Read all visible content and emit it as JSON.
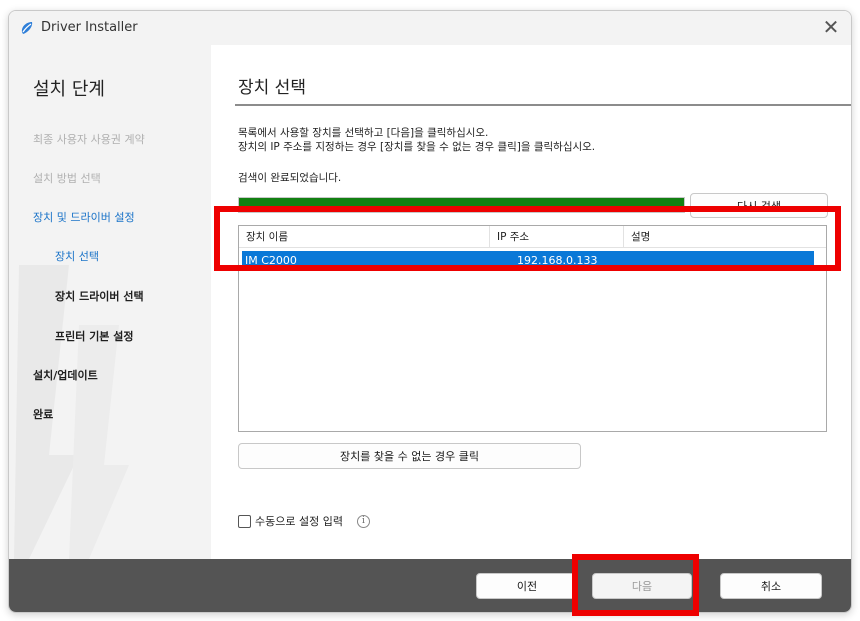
{
  "window": {
    "title": "Driver Installer",
    "close_glyph": "✕"
  },
  "sidebar": {
    "heading": "설치 단계",
    "steps": [
      {
        "label": "최종 사용자 사용권 계약",
        "state": "done"
      },
      {
        "label": "설치 방법 선택",
        "state": "done"
      },
      {
        "label": "장치 및 드라이버 설정",
        "state": "current"
      },
      {
        "label": "장치 선택",
        "state": "current"
      },
      {
        "label": "장치 드라이버 선택",
        "state": "pending"
      },
      {
        "label": "프린터 기본 설정",
        "state": "pending"
      },
      {
        "label": "설치/업데이트",
        "state": "pending"
      },
      {
        "label": "완료",
        "state": "pending"
      }
    ]
  },
  "main": {
    "title": "장치 선택",
    "instructions": [
      "목록에서 사용할 장치를 선택하고 [다음]을 클릭하십시오.",
      "장치의 IP 주소를 지정하는 경우 [장치를 찾을 수 없는 경우 클릭]을 클릭하십시오."
    ],
    "status": "검색이 완료되었습니다.",
    "progress_percent": 100,
    "research_button": "다시 검색",
    "device_table": {
      "columns": [
        "장치 이름",
        "IP 주소",
        "설명"
      ],
      "rows": [
        {
          "name": "IM C2000",
          "ip": "192.168.0.133",
          "description": "",
          "selected": true
        }
      ]
    },
    "not_found_button": "장치를 찾을 수 없는 경우 클릭",
    "manual_checkbox_label": "수동으로 설정 입력",
    "manual_checked": false,
    "info_glyph": "i"
  },
  "footer": {
    "back_button": "이전",
    "next_button": "다음",
    "cancel_button": "취소"
  },
  "colors": {
    "progress_fill": "#128012",
    "selection": "#0a78d7",
    "highlight": "#ee0000",
    "footer": "#545454",
    "current_step": "#1a73c8"
  },
  "icons": {
    "app": "driver-app-icon",
    "close": "close-icon",
    "info": "info-icon"
  }
}
